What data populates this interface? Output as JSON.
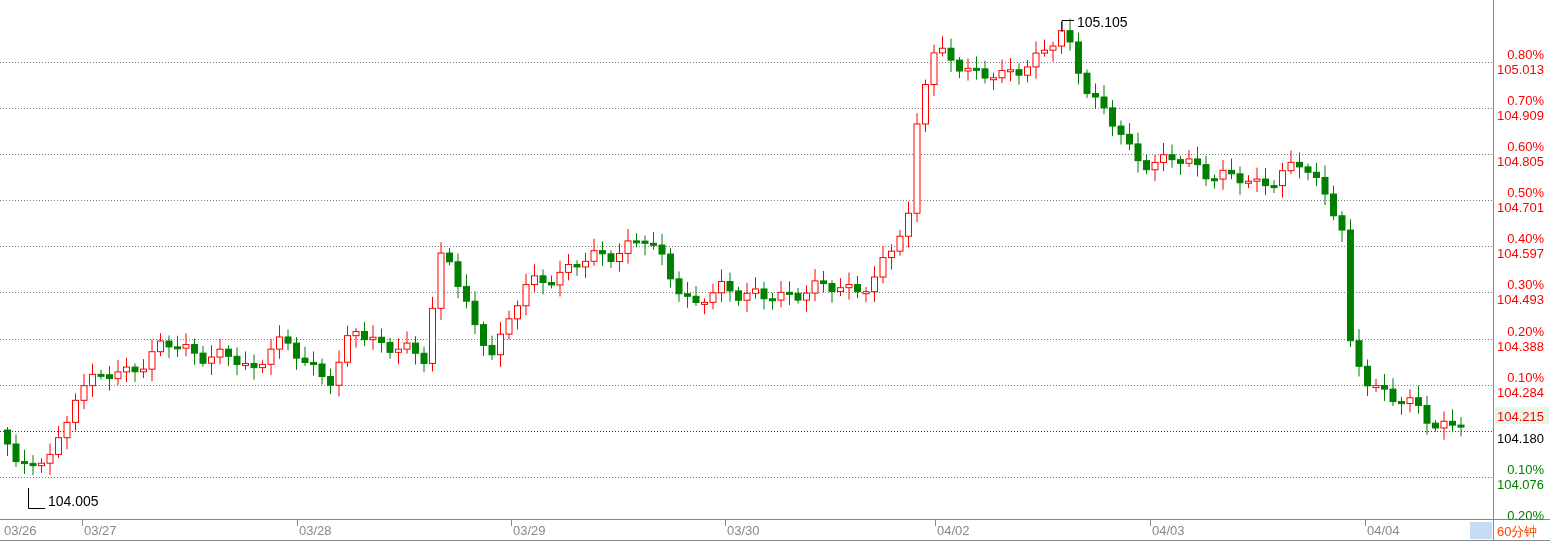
{
  "chart": {
    "annotations": [
      {
        "kind": "high",
        "label": "105.105"
      },
      {
        "kind": "low",
        "label": "104.005"
      }
    ],
    "price_axis": [
      {
        "color": "#ff0000",
        "percent": "0.80%",
        "price": "105.013"
      },
      {
        "color": "#ff0000",
        "percent": "0.70%",
        "price": "104.909"
      },
      {
        "color": "#ff0000",
        "percent": "0.60%",
        "price": "104.805"
      },
      {
        "color": "#ff0000",
        "percent": "0.50%",
        "price": "104.701"
      },
      {
        "color": "#ff0000",
        "percent": "0.40%",
        "price": "104.597"
      },
      {
        "color": "#ff0000",
        "percent": "0.30%",
        "price": "104.493"
      },
      {
        "color": "#ff0000",
        "percent": "0.20%",
        "price": "104.388"
      },
      {
        "color": "#ff0000",
        "percent": "0.10%",
        "price": "104.284"
      },
      {
        "color": "#000000",
        "price": "104.180"
      },
      {
        "color": "#008000",
        "percent": "0.10%",
        "price": "104.076"
      },
      {
        "color": "#008000",
        "percent": "0.20%"
      }
    ],
    "last_price": "104.215",
    "dates": [
      "03/26",
      "03/27",
      "03/28",
      "03/29",
      "03/30",
      "04/02",
      "04/03",
      "04/04"
    ],
    "period": "60分钟"
  }
}
